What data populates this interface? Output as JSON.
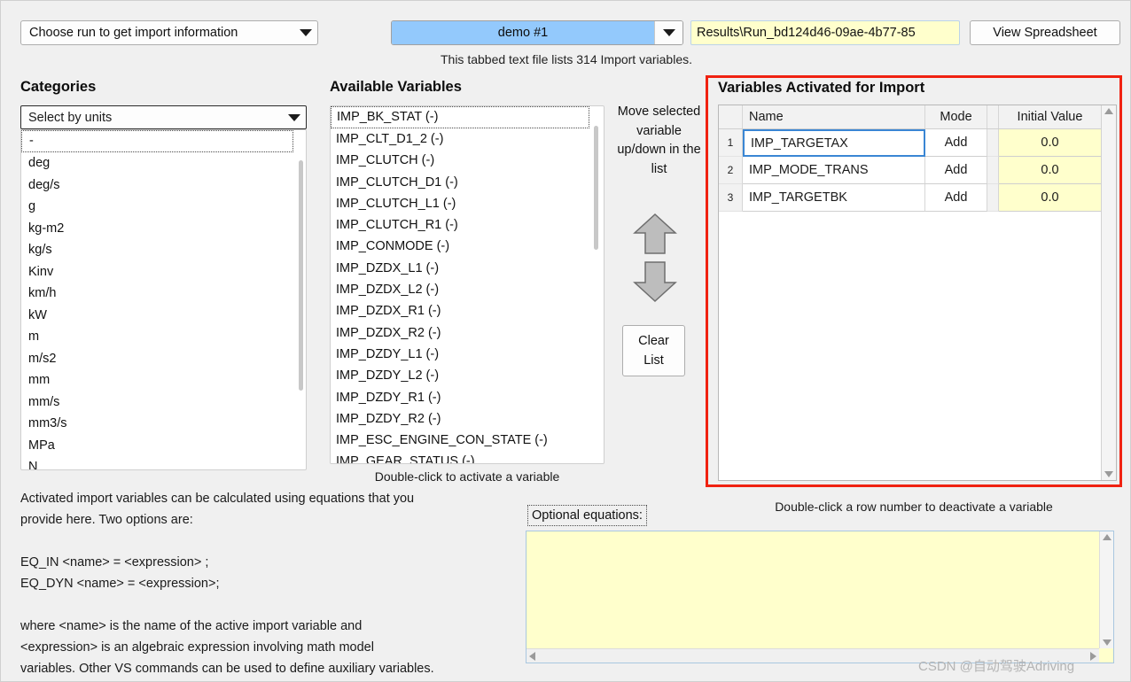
{
  "toolbar": {
    "run_selector_label": "Choose run to get import information",
    "run_name": "demo #1",
    "results_path": "Results\\Run_bd124d46-09ae-4b77-85",
    "view_spreadsheet_label": "View Spreadsheet",
    "status_note": "This tabbed text file lists 314 Import variables."
  },
  "categories": {
    "heading": "Categories",
    "selector_value": "Select by units",
    "items": [
      "-",
      "deg",
      "deg/s",
      "g",
      "kg-m2",
      "kg/s",
      "Kinv",
      "km/h",
      "kW",
      "m",
      "m/s2",
      "mm",
      "mm/s",
      "mm3/s",
      "MPa",
      "N"
    ]
  },
  "available": {
    "heading": "Available Variables",
    "items": [
      "IMP_BK_STAT (-)",
      "IMP_CLT_D1_2 (-)",
      "IMP_CLUTCH (-)",
      "IMP_CLUTCH_D1 (-)",
      "IMP_CLUTCH_L1 (-)",
      "IMP_CLUTCH_R1 (-)",
      "IMP_CONMODE (-)",
      "IMP_DZDX_L1 (-)",
      "IMP_DZDX_L2 (-)",
      "IMP_DZDX_R1 (-)",
      "IMP_DZDX_R2 (-)",
      "IMP_DZDY_L1 (-)",
      "IMP_DZDY_L2 (-)",
      "IMP_DZDY_R1 (-)",
      "IMP_DZDY_R2 (-)",
      "IMP_ESC_ENGINE_CON_STATE (-)",
      "IMP_GEAR_STATUS (-)"
    ],
    "hint": "Double-click to activate a variable"
  },
  "move_controls": {
    "description": "Move\nselected\nvariable\nup/down\nin the list",
    "clear_line1": "Clear",
    "clear_line2": "List"
  },
  "activated": {
    "heading": "Variables Activated for Import",
    "columns": [
      "Name",
      "Mode",
      "Initial Value"
    ],
    "rows": [
      {
        "num": "1",
        "name": "IMP_TARGETAX",
        "mode": "Add",
        "initial": "0.0"
      },
      {
        "num": "2",
        "name": "IMP_MODE_TRANS",
        "mode": "Add",
        "initial": "0.0"
      },
      {
        "num": "3",
        "name": "IMP_TARGETBK",
        "mode": "Add",
        "initial": "0.0"
      }
    ],
    "hint": "Double-click a row number to deactivate a variable",
    "border_color": "#f02211"
  },
  "equations": {
    "blurb": "Activated import variables can be calculated using equations that you\nprovide here. Two options are:\n\nEQ_IN <name> = <expression> ;\nEQ_DYN <name> = <expression>;\n\nwhere <name> is the name of the active import variable and\n<expression> is an algebraic expression involving math model\nvariables. Other VS commands can be used to define auxiliary variables.",
    "label": "Optional equations:",
    "value": "",
    "field_color": "#ffffcc"
  },
  "watermark": "CSDN @自动驾驶Adriving"
}
